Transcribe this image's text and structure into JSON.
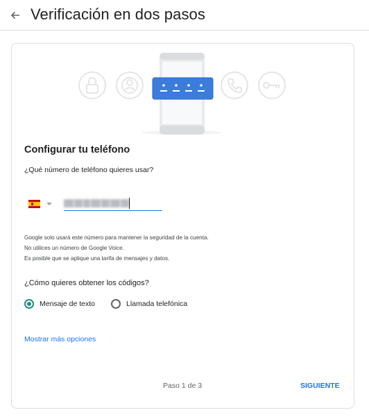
{
  "header": {
    "title": "Verificación en dos pasos"
  },
  "setup": {
    "section_title": "Configurar tu teléfono",
    "phone_question": "¿Qué número de teléfono quieres usar?",
    "country_code": "ES",
    "info_lines": [
      "Google solo usará este número para mantener la seguridad de la cuenta.",
      "No utilices un número de Google Voice.",
      "Es posible que se aplique una tarifa de mensajes y datos."
    ],
    "codes_question": "¿Cómo quieres obtener los códigos?",
    "options": [
      {
        "label": "Mensaje de texto",
        "selected": true
      },
      {
        "label": "Llamada telefónica",
        "selected": false
      }
    ],
    "more_options_link": "Mostrar más opciones"
  },
  "footer": {
    "step": "Paso 1 de 3",
    "next_button": "SIGUIENTE"
  },
  "colors": {
    "accent": "#1a73e8",
    "radio_selected": "#1e8e7e",
    "illustration_code_box": "#3b7ddd"
  },
  "icons": [
    "back-arrow-icon",
    "lock-icon",
    "account-icon",
    "phone-call-icon",
    "key-icon",
    "password-dots-icon"
  ]
}
